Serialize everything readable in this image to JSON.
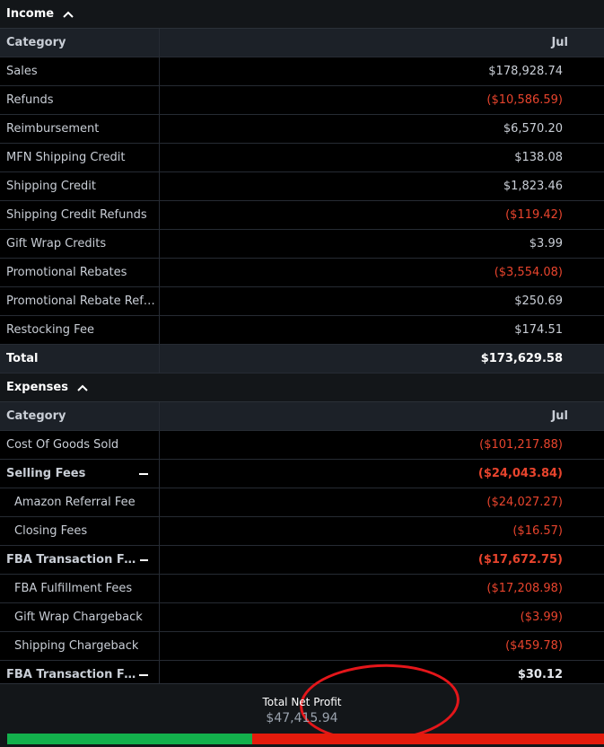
{
  "income": {
    "title": "Income",
    "columns": [
      "Category",
      "Jul"
    ],
    "rows": [
      {
        "label": "Sales",
        "value": "$178,928.74",
        "negative": false
      },
      {
        "label": "Refunds",
        "value": "($10,586.59)",
        "negative": true
      },
      {
        "label": "Reimbursement",
        "value": "$6,570.20",
        "negative": false
      },
      {
        "label": "MFN Shipping Credit",
        "value": "$138.08",
        "negative": false
      },
      {
        "label": "Shipping Credit",
        "value": "$1,823.46",
        "negative": false
      },
      {
        "label": "Shipping Credit Refunds",
        "value": "($119.42)",
        "negative": true
      },
      {
        "label": "Gift Wrap Credits",
        "value": "$3.99",
        "negative": false
      },
      {
        "label": "Promotional Rebates",
        "value": "($3,554.08)",
        "negative": true
      },
      {
        "label": "Promotional Rebate Refu...",
        "value": "$250.69",
        "negative": false
      },
      {
        "label": "Restocking Fee",
        "value": "$174.51",
        "negative": false
      }
    ],
    "total": {
      "label": "Total",
      "value": "$173,629.58"
    }
  },
  "expenses": {
    "title": "Expenses",
    "columns": [
      "Category",
      "Jul"
    ],
    "rows": [
      {
        "label": "Cost Of Goods Sold",
        "value": "($101,217.88)",
        "negative": true,
        "kind": "plain"
      },
      {
        "label": "Selling Fees",
        "value": "($24,043.84)",
        "negative": true,
        "kind": "group"
      },
      {
        "label": "Amazon Referral Fee",
        "value": "($24,027.27)",
        "negative": true,
        "kind": "sub"
      },
      {
        "label": "Closing Fees",
        "value": "($16.57)",
        "negative": true,
        "kind": "sub"
      },
      {
        "label": "FBA Transaction Fees",
        "value": "($17,672.75)",
        "negative": true,
        "kind": "group"
      },
      {
        "label": "FBA Fulfillment Fees",
        "value": "($17,208.98)",
        "negative": true,
        "kind": "sub"
      },
      {
        "label": "Gift Wrap Chargeback",
        "value": "($3.99)",
        "negative": true,
        "kind": "sub"
      },
      {
        "label": "Shipping Chargeback",
        "value": "($459.78)",
        "negative": true,
        "kind": "sub"
      },
      {
        "label": "FBA Transaction Fe...",
        "value": "$30.12",
        "negative": false,
        "kind": "group"
      }
    ]
  },
  "footer": {
    "net_label": "Total Net Profit",
    "net_value": "$47,415.94",
    "profit_bar": {
      "profit_fraction": 0.41,
      "profit_color": "#13b04c",
      "expense_color": "#e41b0c"
    }
  },
  "icons": {
    "collapse": "chevron-up-icon",
    "group_toggle": "minus-icon"
  },
  "colors": {
    "negative": "#e8442d",
    "annotation_ring": "#e4161a"
  }
}
